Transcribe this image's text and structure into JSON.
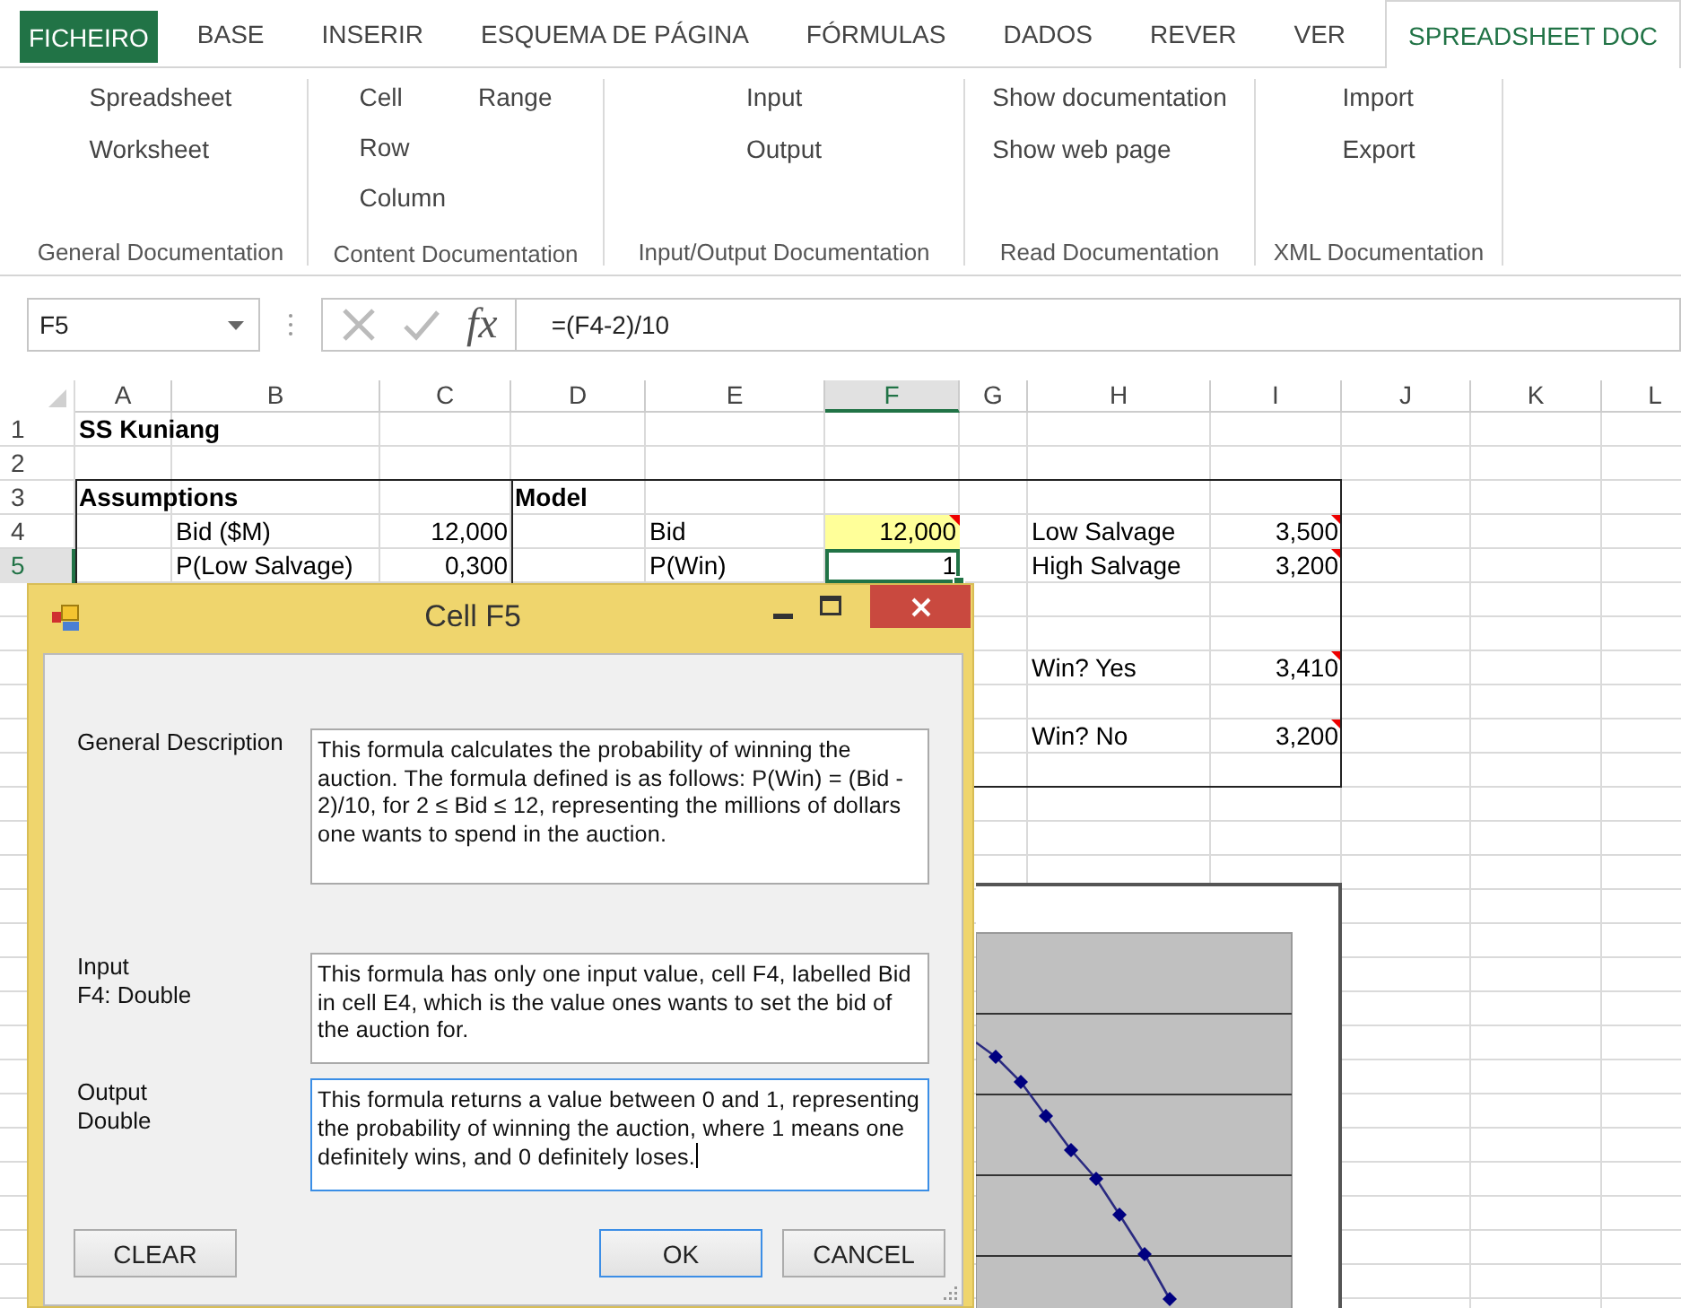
{
  "ribbon": {
    "tabs": [
      {
        "label": "FICHEIRO",
        "kind": "file",
        "selected": false
      },
      {
        "label": "BASE",
        "kind": "tab",
        "selected": false
      },
      {
        "label": "INSERIR",
        "kind": "tab",
        "selected": false
      },
      {
        "label": "ESQUEMA DE PÁGINA",
        "kind": "tab",
        "selected": false
      },
      {
        "label": "FÓRMULAS",
        "kind": "tab",
        "selected": false
      },
      {
        "label": "DADOS",
        "kind": "tab",
        "selected": false
      },
      {
        "label": "REVER",
        "kind": "tab",
        "selected": false
      },
      {
        "label": "VER",
        "kind": "tab",
        "selected": false
      },
      {
        "label": "SPREADSHEET DOC",
        "kind": "tab",
        "selected": true
      }
    ],
    "groups": [
      {
        "label": "General Documentation",
        "columns": [
          [
            "Spreadsheet",
            "Worksheet"
          ]
        ]
      },
      {
        "label": "Content Documentation",
        "columns": [
          [
            "Cell",
            "Row",
            "Column"
          ],
          [
            "Range"
          ]
        ]
      },
      {
        "label": "Input/Output Documentation",
        "columns": [
          [
            "Input",
            "Output"
          ]
        ]
      },
      {
        "label": "Read Documentation",
        "columns": [
          [
            "Show documentation",
            "Show web page"
          ]
        ]
      },
      {
        "label": "XML Documentation",
        "columns": [
          [
            "Import",
            "Export"
          ]
        ]
      }
    ]
  },
  "formula_bar": {
    "name_box": "F5",
    "function_label": "fx",
    "formula": "=(F4-2)/10"
  },
  "sheet": {
    "columns": [
      {
        "label": "A",
        "selected": false
      },
      {
        "label": "B",
        "selected": false
      },
      {
        "label": "C",
        "selected": false
      },
      {
        "label": "D",
        "selected": false
      },
      {
        "label": "E",
        "selected": false
      },
      {
        "label": "F",
        "selected": true
      },
      {
        "label": "G",
        "selected": false
      },
      {
        "label": "H",
        "selected": false
      },
      {
        "label": "I",
        "selected": false
      },
      {
        "label": "J",
        "selected": false
      },
      {
        "label": "K",
        "selected": false
      },
      {
        "label": "L",
        "selected": false
      }
    ],
    "rows": [
      {
        "header": "1",
        "selected": false,
        "cells": [
          {
            "text": "SS Kuniang",
            "kind": "heading",
            "selected": false,
            "highlighted": false,
            "comment": false
          }
        ]
      },
      {
        "header": "2",
        "selected": false
      },
      {
        "header": "3",
        "selected": false,
        "cells": [
          {
            "text": "Assumptions",
            "kind": "heading",
            "selected": false,
            "highlighted": false,
            "comment": false
          },
          null,
          null,
          {
            "text": "Model",
            "kind": "heading",
            "selected": false,
            "highlighted": false,
            "comment": false
          }
        ]
      },
      {
        "header": "4",
        "selected": false,
        "cells": [
          null,
          {
            "text": "Bid ($M)",
            "kind": "text",
            "selected": false,
            "highlighted": false,
            "comment": false
          },
          {
            "text": "12,000",
            "kind": "number",
            "selected": false,
            "highlighted": false,
            "comment": false
          },
          null,
          {
            "text": "Bid",
            "kind": "text",
            "selected": false,
            "highlighted": false,
            "comment": false
          },
          {
            "text": "12,000",
            "kind": "number",
            "selected": false,
            "highlighted": true,
            "comment": true
          },
          null,
          {
            "text": "Low Salvage",
            "kind": "text",
            "selected": false,
            "highlighted": false,
            "comment": false
          },
          {
            "text": "3,500",
            "kind": "number",
            "selected": false,
            "highlighted": false,
            "comment": true
          }
        ]
      },
      {
        "header": "5",
        "selected": true,
        "cells": [
          null,
          {
            "text": "P(Low Salvage)",
            "kind": "text",
            "selected": false,
            "highlighted": false,
            "comment": false
          },
          {
            "text": "0,300",
            "kind": "number",
            "selected": false,
            "highlighted": false,
            "comment": false
          },
          null,
          {
            "text": "P(Win)",
            "kind": "text",
            "selected": false,
            "highlighted": false,
            "comment": false
          },
          {
            "text": "1",
            "kind": "number",
            "selected": true,
            "highlighted": false,
            "comment": false
          },
          null,
          {
            "text": "High Salvage",
            "kind": "text",
            "selected": false,
            "highlighted": false,
            "comment": false
          },
          {
            "text": "3,200",
            "kind": "number",
            "selected": false,
            "highlighted": false,
            "comment": true
          }
        ]
      },
      {},
      {},
      {
        "cells": [
          null,
          null,
          null,
          null,
          null,
          null,
          null,
          {
            "text": "Win? Yes",
            "kind": "text",
            "selected": false,
            "highlighted": false,
            "comment": false
          },
          {
            "text": "3,410",
            "kind": "number",
            "selected": false,
            "highlighted": false,
            "comment": true
          }
        ]
      },
      {},
      {
        "cells": [
          null,
          null,
          null,
          null,
          null,
          null,
          null,
          {
            "text": "Win? No",
            "kind": "text",
            "selected": false,
            "highlighted": false,
            "comment": false
          },
          {
            "text": "3,200",
            "kind": "number",
            "selected": false,
            "highlighted": false,
            "comment": true
          }
        ]
      }
    ]
  },
  "dialog": {
    "title": "Cell F5",
    "fields": [
      {
        "label": "General Description",
        "value": "This formula calculates the probability of winning the auction. The formula defined is as follows: P(Win) = (Bid - 2)/10, for 2 ≤ Bid ≤ 12, representing the millions of dollars one wants to spend in the auction.",
        "focused": false
      },
      {
        "label": "Input",
        "type": "F4: Double",
        "value": "This formula has only one input value, cell F4, labelled Bid in cell E4, which is the value ones wants to set the bid of the auction for.",
        "focused": false
      },
      {
        "label": "Output",
        "type": "Double",
        "value": "This formula returns a value between 0 and 1, representing the probability of winning the auction, where 1 means one definitely wins, and 0 definitely loses.",
        "focused": true
      }
    ],
    "buttons": [
      {
        "label": "CLEAR",
        "default": false
      },
      {
        "label": "OK",
        "default": true
      },
      {
        "label": "CANCEL",
        "default": false
      }
    ]
  }
}
